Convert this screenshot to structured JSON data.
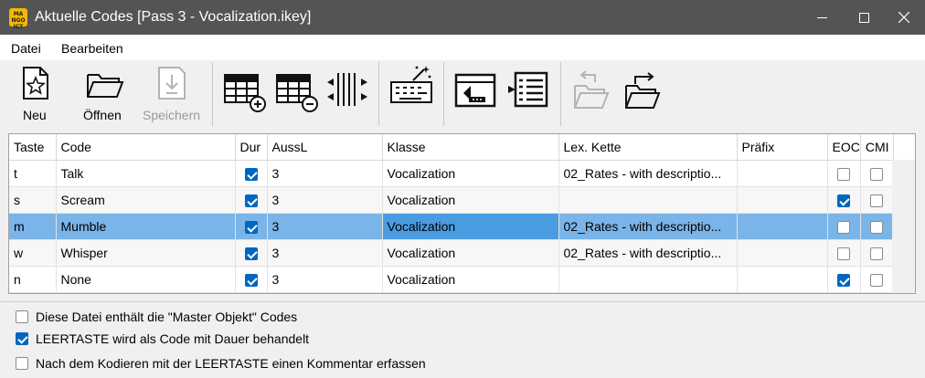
{
  "window": {
    "title": "Aktuelle Codes [Pass 3 - Vocalization.ikey]",
    "app_icon_text": "INTERACT"
  },
  "menu": [
    "Datei",
    "Bearbeiten"
  ],
  "toolbar": {
    "new_label": "Neu",
    "open_label": "Öffnen",
    "save_label": "Speichern"
  },
  "table": {
    "headers": [
      "Taste",
      "Code",
      "Dur",
      "AussL",
      "Klasse",
      "Lex. Kette",
      "Präfix",
      "EOC",
      "CMI"
    ],
    "rows": [
      {
        "taste": "t",
        "code": "Talk",
        "dur": true,
        "aussl": "3",
        "klasse": "Vocalization",
        "lex": "02_Rates - with descriptio...",
        "praefix": "",
        "eoc": false,
        "cmi": false
      },
      {
        "taste": "s",
        "code": "Scream",
        "dur": true,
        "aussl": "3",
        "klasse": "Vocalization",
        "lex": "",
        "praefix": "",
        "eoc": true,
        "cmi": false
      },
      {
        "taste": "m",
        "code": "Mumble",
        "dur": true,
        "aussl": "3",
        "klasse": "Vocalization",
        "lex": "02_Rates - with descriptio...",
        "praefix": "",
        "eoc": false,
        "cmi": false,
        "selected": true
      },
      {
        "taste": "w",
        "code": "Whisper",
        "dur": true,
        "aussl": "3",
        "klasse": "Vocalization",
        "lex": "02_Rates - with descriptio...",
        "praefix": "",
        "eoc": false,
        "cmi": false
      },
      {
        "taste": "n",
        "code": "None",
        "dur": true,
        "aussl": "3",
        "klasse": "Vocalization",
        "lex": "",
        "praefix": "",
        "eoc": true,
        "cmi": false
      }
    ]
  },
  "options": [
    {
      "label": "Diese Datei enthält die \"Master Objekt\" Codes",
      "checked": false
    },
    {
      "label": "LEERTASTE wird als Code mit Dauer behandelt",
      "checked": true
    },
    {
      "label": "Nach dem Kodieren mit der LEERTASTE einen Kommentar erfassen",
      "checked": false
    }
  ],
  "colors": {
    "titlebar": "#545454",
    "selection": "#7ab4e8",
    "selection_active": "#4a9be0",
    "checkbox_on": "#0067c0"
  }
}
